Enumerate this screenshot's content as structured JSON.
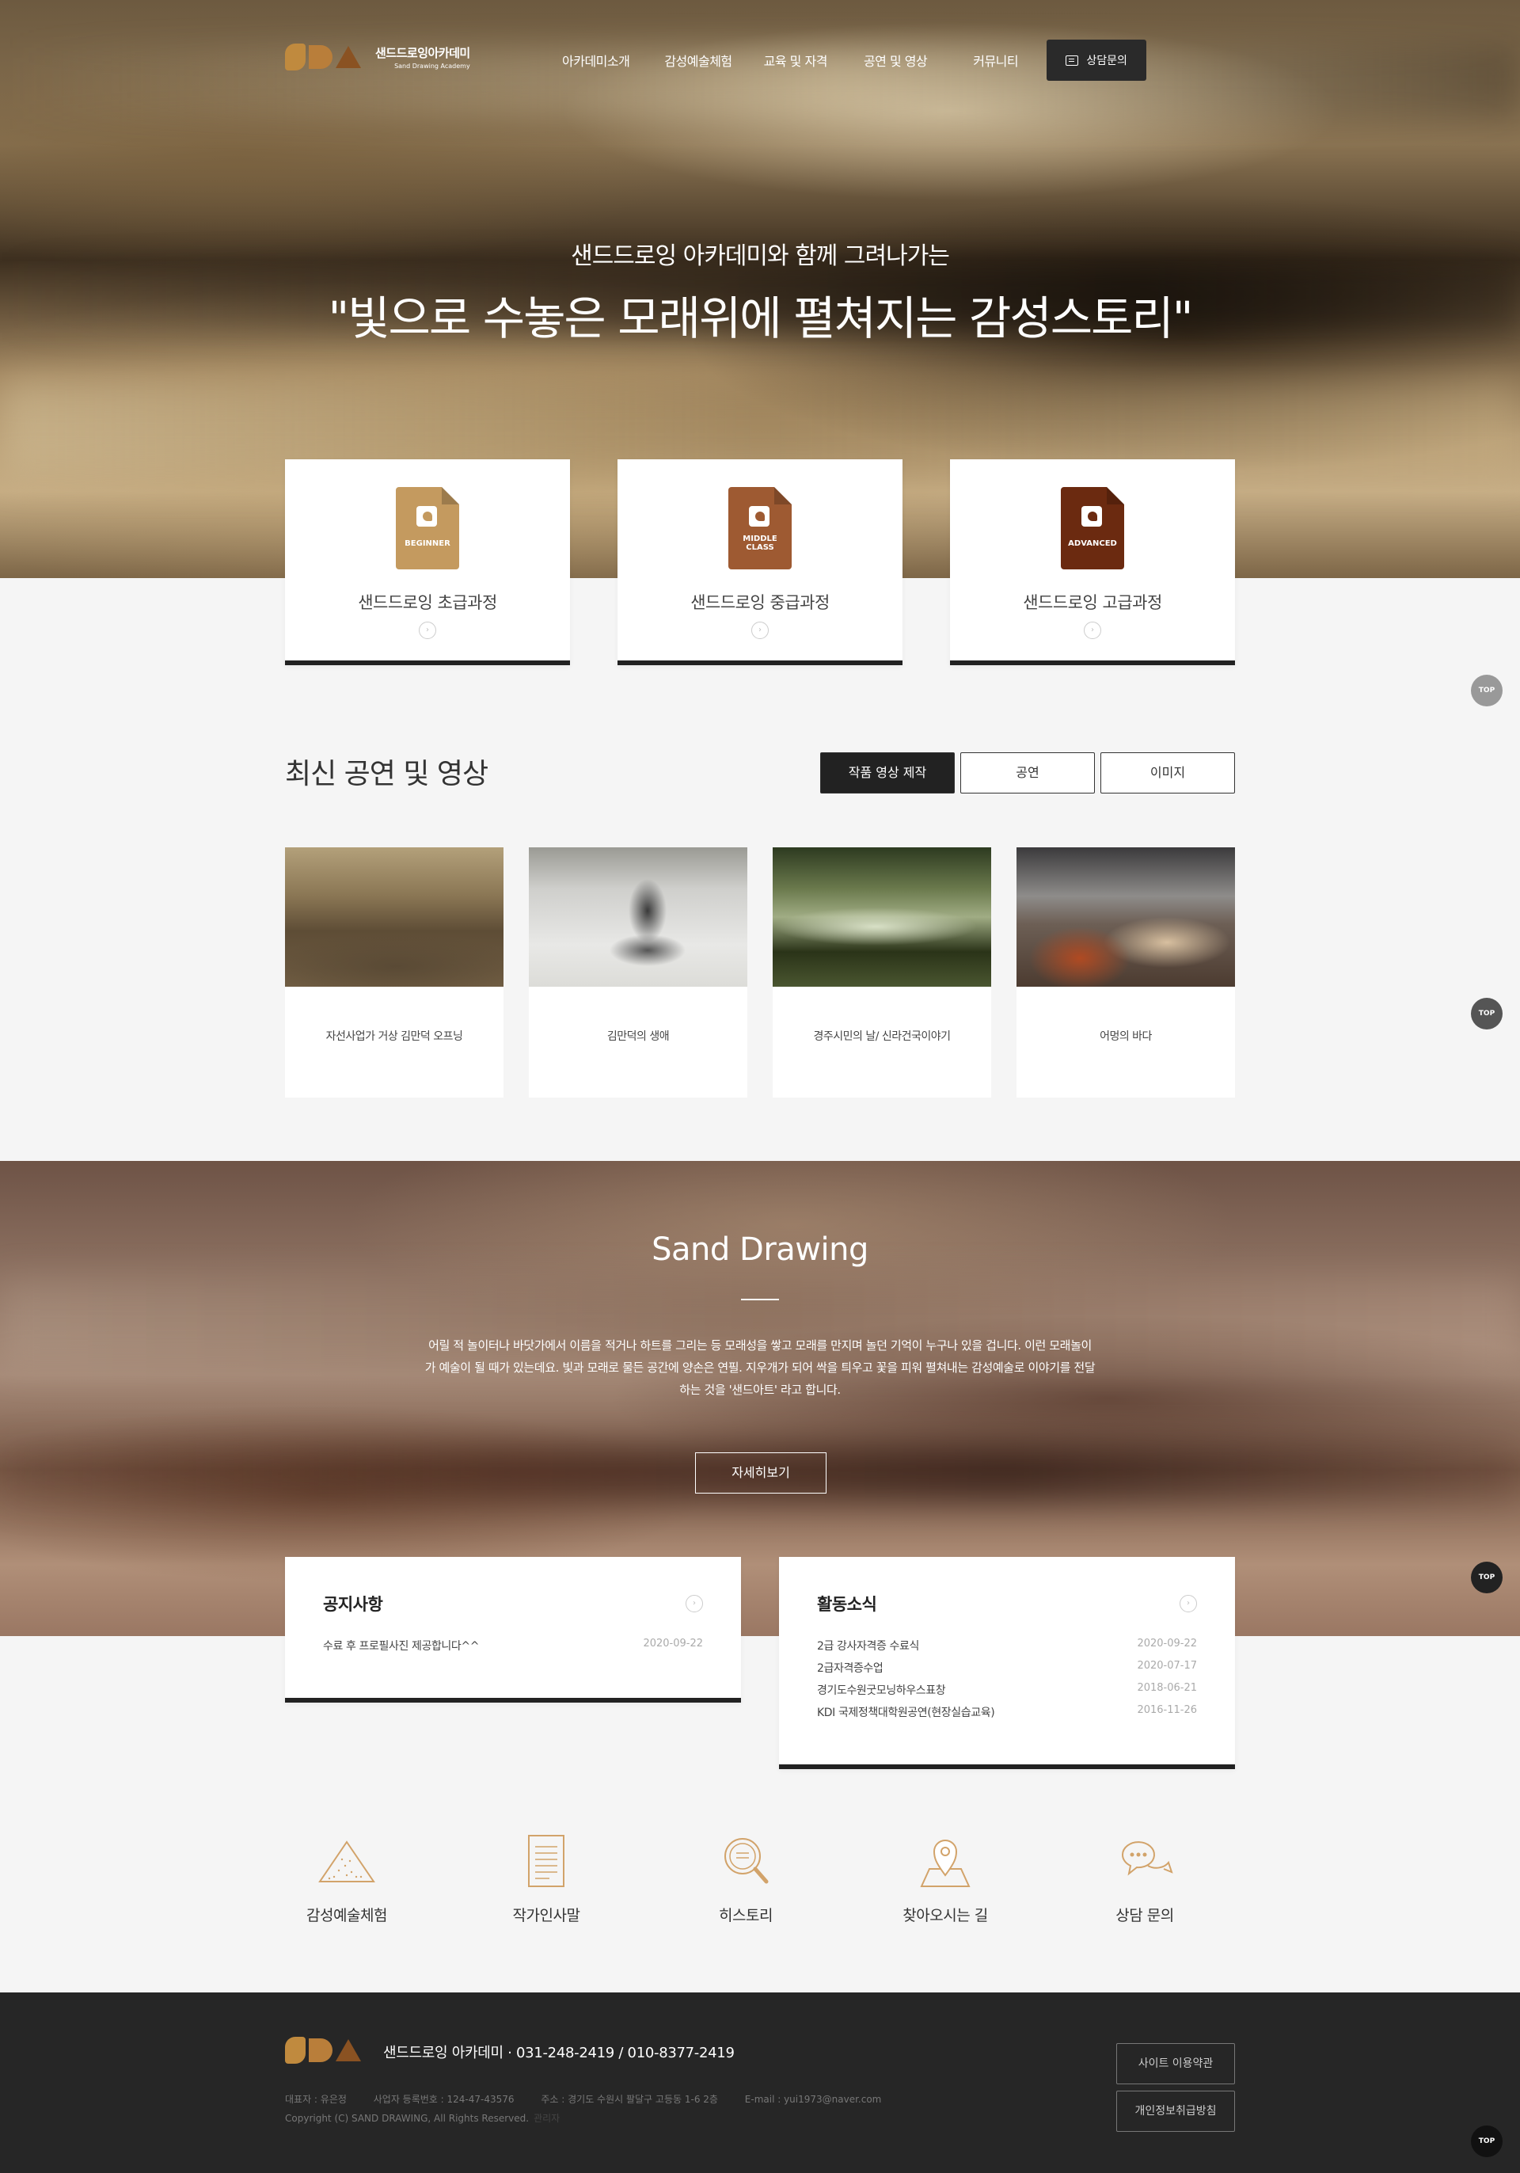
{
  "header": {
    "logo_title": "샌드드로잉아카데미",
    "logo_sub": "Sand Drawing Academy",
    "nav": [
      "아카데미소개",
      "감성예술체험",
      "교육 및 자격",
      "공연 및 영상",
      "커뮤니티"
    ],
    "consult_label": "상담문의"
  },
  "hero": {
    "subtitle": "샌드드로잉 아카데미와 함께 그려나가는",
    "title": "\"빛으로 수놓은 모래위에 펼쳐지는 감성스토리\""
  },
  "courses": [
    {
      "level": "BEGINNER",
      "title": "샌드드로잉 초급과정",
      "color": "#c49a5f"
    },
    {
      "level": "MIDDLE CLASS",
      "title": "샌드드로잉 중급과정",
      "color": "#9e5a32"
    },
    {
      "level": "ADVANCED",
      "title": "샌드드로잉 고급과정",
      "color": "#6b2a10"
    }
  ],
  "latest": {
    "title": "최신 공연 및 영상",
    "tabs": [
      "작품 영상 제작",
      "공연",
      "이미지"
    ],
    "videos": [
      {
        "title": "자선사업가 거상 김만덕 오프닝"
      },
      {
        "title": "김만덕의 생애"
      },
      {
        "title": "경주시민의 날/ 신라건국이야기"
      },
      {
        "title": "어멍의 바다"
      }
    ]
  },
  "sand": {
    "title": "Sand Drawing",
    "text_lines": [
      "어릴 적 놀이터나 바닷가에서 이름을 적거나 하트를 그리는 등 모래성을 쌓고 모래를 만지며 놀던 기억이 누구나 있을 겁니다. 이런 모래놀이",
      "가 예술이 될 때가 있는데요. 빛과 모래로 물든 공간에 양손은 연필. 지우개가 되어 싹을 틔우고 꽃을 피워 펼쳐내는 감성예술로 이야기를 전달",
      "하는 것을 '샌드아트' 라고 합니다."
    ],
    "button": "자세히보기"
  },
  "notice": {
    "title": "공지사항",
    "rows": [
      {
        "text": "수료 후 프로필사진 제공합니다^^",
        "date": "2020-09-22"
      }
    ]
  },
  "activity": {
    "title": "활동소식",
    "rows": [
      {
        "text": "2급 강사자격증 수료식",
        "date": "2020-09-22"
      },
      {
        "text": "2급자격증수업",
        "date": "2020-07-17"
      },
      {
        "text": "경기도수원굿모닝하우스표창",
        "date": "2018-06-21"
      },
      {
        "text": "KDI 국제정책대학원공연(현장실습교육)",
        "date": "2016-11-26"
      }
    ]
  },
  "quick": [
    {
      "label": "감성예술체험",
      "icon": "pyramid-icon"
    },
    {
      "label": "작가인사말",
      "icon": "document-icon"
    },
    {
      "label": "히스토리",
      "icon": "magnifier-icon"
    },
    {
      "label": "찾아오시는 길",
      "icon": "map-pin-icon"
    },
    {
      "label": "상담 문의",
      "icon": "chat-bubble-icon"
    }
  ],
  "footer": {
    "line": "샌드드로잉 아카데미 · 031-248-2419 / 010-8377-2419",
    "ceo": "대표자 : 유은정",
    "biz": "사업자 등록번호 : 124-47-43576",
    "addr": "주소 : 경기도 수원시 팔달구 고등동 1-6 2층",
    "email": "E-mail : yui1973@naver.com",
    "copyright": "Copyright (C) SAND DRAWING, All Rights Reserved.",
    "admin": "관리자",
    "terms": "사이트 이용약관",
    "privacy": "개인정보취급방침"
  },
  "top_label": "TOP",
  "colors": {
    "accent": "#c49a5f",
    "dark": "#222222",
    "icon_line": "#d2a36a"
  }
}
